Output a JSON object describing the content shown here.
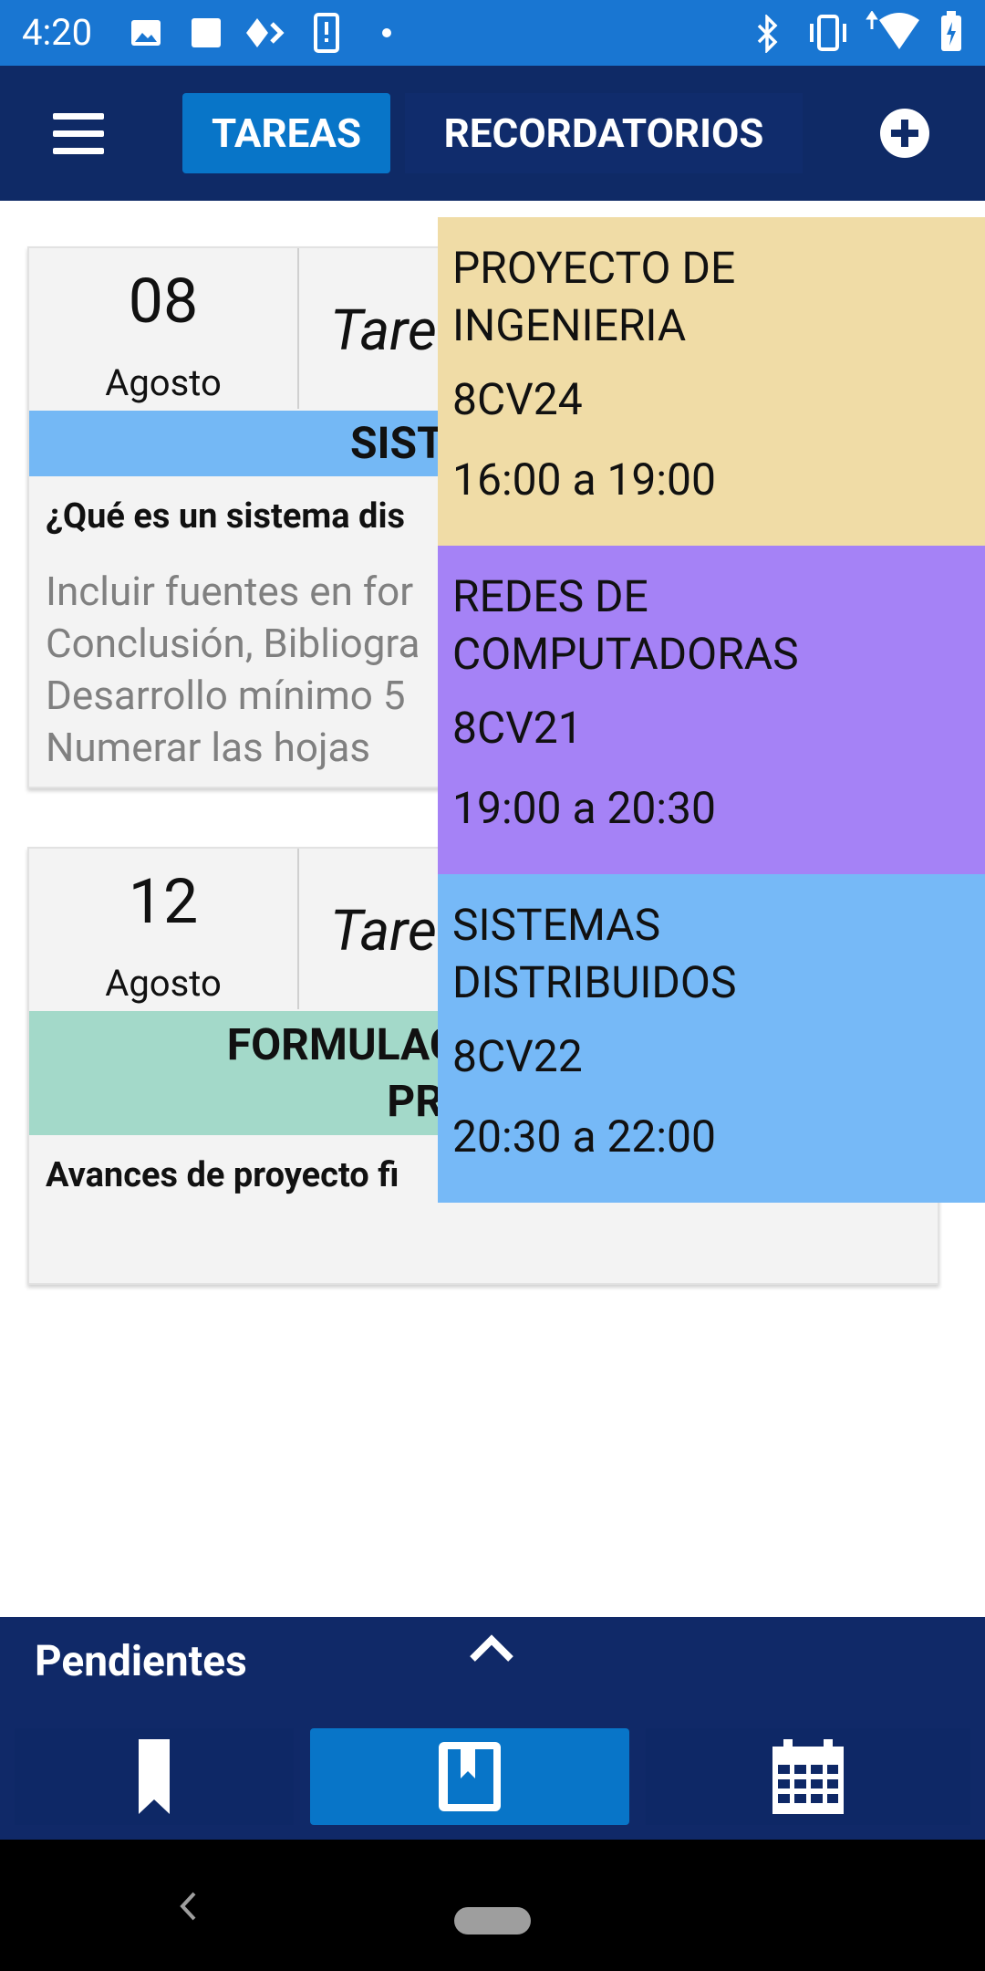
{
  "status_bar": {
    "time": "4:20",
    "left_icons": [
      "image-icon",
      "square-icon",
      "diamond-icon",
      "phone-alert-icon",
      "dot-icon"
    ],
    "right_icons": [
      "bluetooth-icon",
      "vibrate-icon",
      "wifi-icon",
      "battery-icon"
    ],
    "background": "#1976d2"
  },
  "app_bar": {
    "tabs": [
      {
        "label": "TAREAS",
        "active": true
      },
      {
        "label": "RECORDATORIOS",
        "active": false
      }
    ],
    "background": "#0f2a66",
    "accent": "#0875c8"
  },
  "tasks": [
    {
      "day": "08",
      "month": "Agosto",
      "kind": "Tare",
      "subject": "SISTEMAS I",
      "subject_color": "#74b8f5",
      "title": "¿Qué es un sistema dis",
      "description": [
        "Incluir fuentes en for",
        "Conclusión, Bibliogra",
        "Desarrollo mínimo 5",
        "Numerar las hojas"
      ]
    },
    {
      "day": "12",
      "month": "Agosto",
      "kind": "Tare",
      "subject_lines": [
        "FORMULACION",
        "PROY"
      ],
      "subject_color": "#a3d9c9",
      "title": "Avances de proyecto fi"
    }
  ],
  "schedule": [
    {
      "name_lines": [
        "PROYECTO DE",
        "INGENIERIA"
      ],
      "group": "8CV24",
      "time": "16:00 a 19:00",
      "color": "#f0dca6"
    },
    {
      "name_lines": [
        "REDES DE",
        "COMPUTADORAS"
      ],
      "group": "8CV21",
      "time": "19:00 a 20:30",
      "color": "#a582f6"
    },
    {
      "name_lines": [
        "SISTEMAS",
        "DISTRIBUIDOS"
      ],
      "group": "8CV22",
      "time": "20:30 a 22:00",
      "color": "#76b9f7"
    }
  ],
  "bottom_panel": {
    "label": "Pendientes",
    "nav_icons": [
      "bookmark-icon",
      "book-icon",
      "calendar-icon"
    ],
    "active_index": 1
  }
}
